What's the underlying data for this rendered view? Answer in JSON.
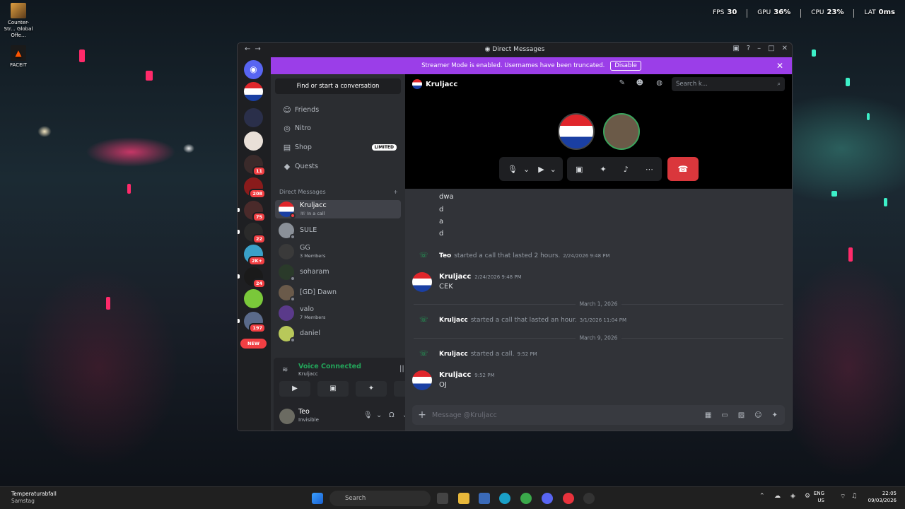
{
  "desktop": {
    "icons": [
      {
        "label": "Counter-Str... Global Offe..."
      },
      {
        "label": "FACEIT"
      }
    ],
    "hud": {
      "fps_label": "FPS",
      "fps": "30",
      "gpu_label": "GPU",
      "gpu": "36%",
      "cpu_label": "CPU",
      "cpu": "23%",
      "lat_label": "LAT",
      "lat": "0ms"
    }
  },
  "window": {
    "title": "Direct Messages",
    "nav_back": "←",
    "nav_fwd": "→"
  },
  "banner": {
    "text": "Streamer Mode is enabled. Usernames have been truncated.",
    "button": "Disable"
  },
  "sidebar": {
    "find": "Find or start a conversation",
    "nav": [
      {
        "label": "Friends"
      },
      {
        "label": "Nitro"
      },
      {
        "label": "Shop",
        "badge": "LIMITED"
      },
      {
        "label": "Quests"
      }
    ],
    "dm_header": "Direct Messages",
    "dms": [
      {
        "name": "Kruljacc",
        "sub": "In a call"
      },
      {
        "name": "SULE",
        "sub": ""
      },
      {
        "name": "GG",
        "sub": "3 Members"
      },
      {
        "name": "soharam",
        "sub": ""
      },
      {
        "name": "[GD] Dawn",
        "sub": ""
      },
      {
        "name": "valo",
        "sub": "7 Members"
      },
      {
        "name": "daniel",
        "sub": ""
      }
    ]
  },
  "servers": {
    "badges": [
      "11",
      "208",
      "75",
      "22",
      "2K+",
      "24",
      "197",
      "NEW"
    ]
  },
  "voice": {
    "status": "Voice Connected",
    "channel": "Kruljacc"
  },
  "user": {
    "name": "Teo",
    "status": "Invisible"
  },
  "chat": {
    "name": "Kruljacc",
    "search_placeholder": "Search k...",
    "lines": [
      "dwa",
      "d",
      "a",
      "d"
    ],
    "sys1": {
      "who": "Teo",
      "text": "started a call that lasted 2 hours.",
      "ts": "2/24/2026 9:48 PM"
    },
    "msg1": {
      "author": "Kruljacc",
      "ts": "2/24/2026 9:48 PM",
      "text": "CEK"
    },
    "div1": "March 1, 2026",
    "sys2": {
      "who": "Kruljacc",
      "text": "started a call that lasted an hour.",
      "ts": "3/1/2026 11:04 PM"
    },
    "div2": "March 9, 2026",
    "sys3": {
      "who": "Kruljacc",
      "text": "started a call.",
      "ts": "9:52 PM"
    },
    "msg2": {
      "author": "Kruljacc",
      "ts": "9:52 PM",
      "text": "OJ"
    },
    "composer_placeholder": "Message @Kruljacc"
  },
  "taskbar": {
    "weather": "Temperaturabfall",
    "weather_sub": "Samstag",
    "search": "Search",
    "lang": "ENG",
    "region": "US",
    "time": "22:05",
    "date": "09/03/2026"
  }
}
